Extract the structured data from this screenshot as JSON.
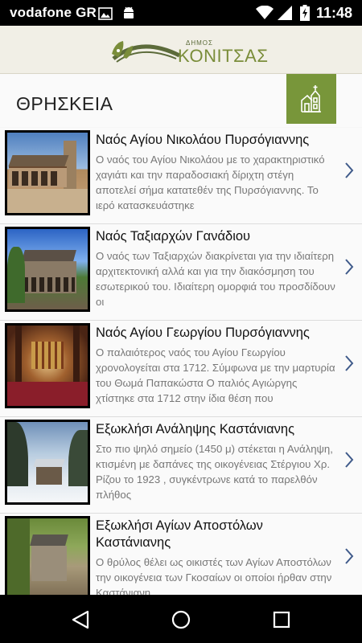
{
  "status_bar": {
    "carrier": "vodafone GR",
    "time": "11:48",
    "icons": [
      "image-icon",
      "android-icon",
      "wifi-icon",
      "signal-icon",
      "battery-charging-icon"
    ]
  },
  "app_bar": {
    "logo_small": "ΔΗΜΟΣ",
    "logo_main": "ΚΟΝΙΤΣΑΣ",
    "accent_color": "#7a8d3a"
  },
  "page": {
    "title": "ΘΡΗΣΚΕΙΑ",
    "badge_icon": "church-icon",
    "badge_color": "#78963a"
  },
  "items": [
    {
      "title": "Ναός Αγίου Νικολάου Πυρσόγιαννης",
      "description": "Ο ναός του Αγίου Νικολάου με το χαρακτηριστικό χαγιάτι και την παραδοσιακή δίριχτη στέγη αποτελεί σήμα κατατεθέν της Πυρσόγιαννης. Το ιερό κατασκευάστηκε",
      "thumb_icon": "church-photo"
    },
    {
      "title": "Ναός Ταξιαρχών Γανάδιου",
      "description": "Ο ναός των Ταξιαρχών διακρίνεται για την ιδιαίτερη αρχιτεκτονική αλλά και για την διακόσμηση του εσωτερικού του. Ιδιαίτερη ομορφιά του προσδίδουν οι",
      "thumb_icon": "church-photo"
    },
    {
      "title": "Ναός Αγίου Γεωργίου Πυρσόγιαννης",
      "description": "Ο παλαιότερος ναός του Αγίου Γεωργίου χρονολογείται στα 1712. Σύμφωνα με την μαρτυρία του Θωμά Παπακώστα Ο παλιός Αγιώργης χτίστηκε στα 1712 στην ίδια θέση που",
      "thumb_icon": "church-interior-photo"
    },
    {
      "title": "Εξωκλήσι Ανάληψης Καστάνιανης",
      "description": "Στο πιο ψηλό σημείο (1450 μ) στέκεται η Ανάληψη, κτισμένη με δαπάνες της οικογένειας Στέργιου Χρ. Ρίζου το 1923 , συγκέντρωνε κατά το παρελθόν πλήθος",
      "thumb_icon": "chapel-snow-photo"
    },
    {
      "title": "Εξωκλήσι Αγίων Αποστόλων Καστάνιανης",
      "description": "Ο θρύλος θέλει ως οικιστές των Αγίων Αποστόλων την οικογένεια των Γκοσαίων οι οποίοι ήρθαν στην Καστάνιανη",
      "thumb_icon": "chapel-forest-photo"
    }
  ],
  "nav_bar": {
    "back": "back-icon",
    "home": "home-icon",
    "recents": "recents-icon"
  }
}
